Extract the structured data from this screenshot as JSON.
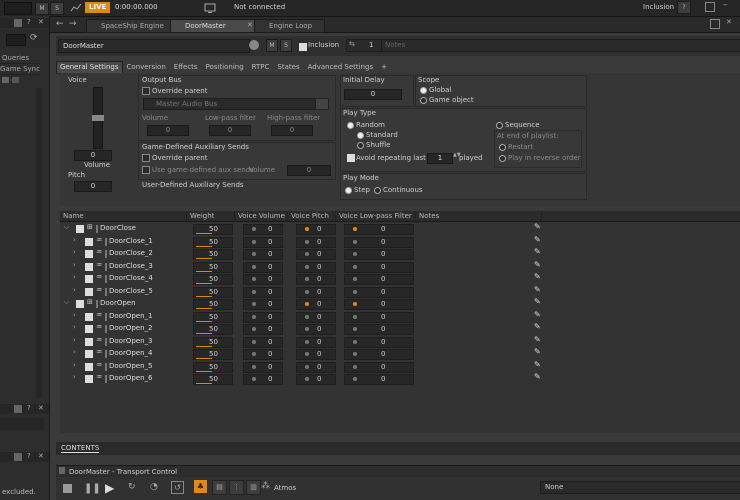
{
  "topbar": {
    "btn1": "M",
    "btn2": "S",
    "live_label": "LIVE",
    "time": "0:00:00.000",
    "connection": "Not connected",
    "inclusion": "Inclusion",
    "help": "?"
  },
  "left_panel": {
    "item1": "Queries",
    "item2": "Game Syncs",
    "excluded": "excluded."
  },
  "tabs": [
    {
      "label": "SpaceShip Engine"
    },
    {
      "label": "DoorMaster"
    },
    {
      "label": "Engine Loop"
    }
  ],
  "header": {
    "object_name": "DoorMaster",
    "m": "M",
    "s": "S",
    "inclusion": "Inclusion",
    "count": "1",
    "notes_placeholder": "Notes"
  },
  "subtabs": [
    "General Settings",
    "Conversion",
    "Effects",
    "Positioning",
    "RTPC",
    "States",
    "Advanced Settings",
    "+"
  ],
  "general": {
    "voice_label": "Voice",
    "volume_value": "0",
    "volume_label": "Volume",
    "pitch_label": "Pitch",
    "pitch_value": "0",
    "output_bus_title": "Output Bus",
    "override_parent": "Override parent",
    "master_bus": "Master Audio Bus",
    "col_volume": "Volume",
    "col_lowpass": "Low-pass filter",
    "col_highpass": "High-pass filter",
    "v0": "0",
    "v1": "0",
    "v2": "0",
    "gda_title": "Game-Defined Auxiliary Sends",
    "gda_override": "Override parent",
    "gda_use": "Use game-defined aux sends",
    "gda_volume": "Volume",
    "gda_value": "0",
    "uda_title": "User-Defined Auxiliary Sends",
    "initial_delay_title": "Initial Delay",
    "initial_delay_value": "0",
    "scope_title": "Scope",
    "scope_global": "Global",
    "scope_game_object": "Game object",
    "play_type_title": "Play Type",
    "random": "Random",
    "standard": "Standard",
    "shuffle": "Shuffle",
    "avoid_repeating": "Avoid repeating last",
    "avoid_value": "1",
    "played": "played",
    "sequence": "Sequence",
    "at_end": "At end of playlist:",
    "restart": "Restart",
    "play_reverse": "Play in reverse order",
    "play_mode_title": "Play Mode",
    "step": "Step",
    "continuous": "Continuous"
  },
  "list": {
    "columns": [
      "Name",
      "Weight",
      "Voice Volume",
      "Voice Pitch",
      "Voice Low-pass Filter",
      "Notes"
    ],
    "rows": [
      {
        "name": "DoorClose",
        "weight": "50",
        "vol": "0",
        "pitch": "0",
        "lpf": "0",
        "group": true
      },
      {
        "name": "DoorClose_1",
        "weight": "50",
        "vol": "0",
        "pitch": "0",
        "lpf": "0",
        "group": false
      },
      {
        "name": "DoorClose_2",
        "weight": "50",
        "vol": "0",
        "pitch": "0",
        "lpf": "0",
        "group": false
      },
      {
        "name": "DoorClose_3",
        "weight": "50",
        "vol": "0",
        "pitch": "0",
        "lpf": "0",
        "group": false
      },
      {
        "name": "DoorClose_4",
        "weight": "50",
        "vol": "0",
        "pitch": "0",
        "lpf": "0",
        "group": false
      },
      {
        "name": "DoorClose_5",
        "weight": "50",
        "vol": "0",
        "pitch": "0",
        "lpf": "0",
        "group": false
      },
      {
        "name": "DoorOpen",
        "weight": "50",
        "vol": "0",
        "pitch": "0",
        "lpf": "0",
        "group": true
      },
      {
        "name": "DoorOpen_1",
        "weight": "50",
        "vol": "0",
        "pitch": "0",
        "lpf": "0",
        "group": false
      },
      {
        "name": "DoorOpen_2",
        "weight": "50",
        "vol": "0",
        "pitch": "0",
        "lpf": "0",
        "group": false
      },
      {
        "name": "DoorOpen_3",
        "weight": "50",
        "vol": "0",
        "pitch": "0",
        "lpf": "0",
        "group": false
      },
      {
        "name": "DoorOpen_4",
        "weight": "50",
        "vol": "0",
        "pitch": "0",
        "lpf": "0",
        "group": false
      },
      {
        "name": "DoorOpen_5",
        "weight": "50",
        "vol": "0",
        "pitch": "0",
        "lpf": "0",
        "group": false
      },
      {
        "name": "DoorOpen_6",
        "weight": "50",
        "vol": "0",
        "pitch": "0",
        "lpf": "0",
        "group": false
      }
    ]
  },
  "contents_label": "CONTENTS",
  "transport": {
    "title": "DoorMaster - Transport Control",
    "atmos": "Atmos",
    "none": "None"
  },
  "colors": {
    "accent": "#e08a14",
    "background": "#3a3a3a"
  }
}
